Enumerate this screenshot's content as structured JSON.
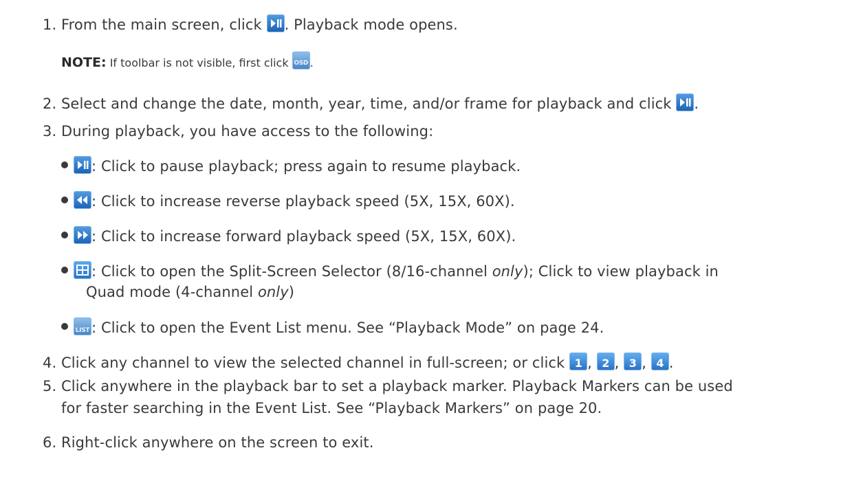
{
  "steps": [
    {
      "num": "1.",
      "pre": "From the main screen, click",
      "icon": "play-pause-icon",
      "post": ". Playback mode opens."
    },
    {
      "num": "2.",
      "pre": "Select and change the date, month, year, time, and/or frame for playback and click",
      "icon": "play-pause-icon",
      "post": "."
    },
    {
      "num": "3.",
      "text": "During playback, you have access to the following:"
    },
    {
      "num": "4.",
      "pre": "Click any channel to view the selected channel in full-screen; or click",
      "icons": [
        "1",
        "2",
        "3",
        "4"
      ],
      "sep": ",",
      "post": "."
    },
    {
      "num": "5.",
      "line1": "Click anywhere in the playback bar to set a playback marker. Playback Markers can be used",
      "line2": "for faster searching in the Event List. See “Playback Markers” on page 20."
    },
    {
      "num": "6.",
      "text": "Right-click anywhere on the screen to exit."
    }
  ],
  "note": {
    "label": "NOTE:",
    "text": "If toolbar is not visible, first click",
    "icon_text": "OSD",
    "post": "."
  },
  "bullets": [
    {
      "icon": "play-pause-icon",
      "text": ": Click to pause playback; press again to resume playback."
    },
    {
      "icon": "rewind-icon",
      "text": ": Click to increase reverse playback speed (5X, 15X, 60X)."
    },
    {
      "icon": "fast-forward-icon",
      "text": ": Click to increase forward playback speed (5X, 15X, 60X)."
    },
    {
      "icon": "split-screen-icon",
      "text_a": ": Click to open the Split-Screen Selector (8/16-channel ",
      "em_a": "only",
      "text_b": "); Click to view playback in",
      "line2_a": "Quad mode (4-channel ",
      "em_b": "only",
      "line2_b": ")"
    },
    {
      "icon": "list-icon",
      "icon_text": "LIST",
      "text": ": Click to open the Event List menu. See “Playback Mode” on page 24."
    }
  ]
}
